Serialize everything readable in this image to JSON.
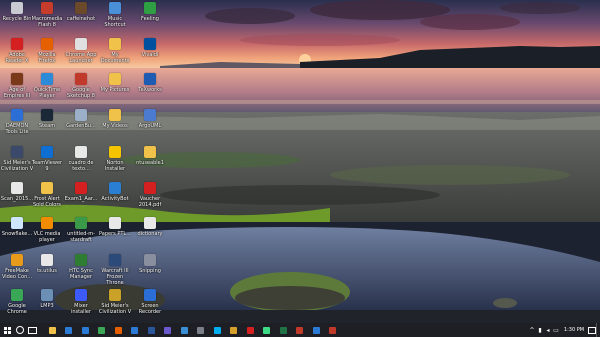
{
  "desktop": {
    "icons": [
      {
        "label": "Recycle Bin",
        "icon": "recycle-bin-icon",
        "color": "#c8ccd2"
      },
      {
        "label": "Adobe Reader X",
        "icon": "adobe-reader-icon",
        "color": "#d42020"
      },
      {
        "label": "Age of Empires III",
        "icon": "age-of-empires-icon",
        "color": "#7a3a1a"
      },
      {
        "label": "DAEMON Tools Lite",
        "icon": "daemon-tools-icon",
        "color": "#2b6fd6"
      },
      {
        "label": "Sid Meier's Civilization V",
        "icon": "civilization-icon",
        "color": "#3b4a6b"
      },
      {
        "label": "Scan_2015...",
        "icon": "document-icon",
        "color": "#e8e8e8"
      },
      {
        "label": "Snowflake...",
        "icon": "snowflake-icon",
        "color": "#cfe6ff"
      },
      {
        "label": "FreeMake Video Con...",
        "icon": "freemake-icon",
        "color": "#e89a1a"
      },
      {
        "label": "Google Chrome",
        "icon": "chrome-icon",
        "color": "#3aa757"
      },
      {
        "label": "Macromedia Flash 8",
        "icon": "flash-icon",
        "color": "#c63c2a"
      },
      {
        "label": "Mozilla Firefox",
        "icon": "firefox-icon",
        "color": "#e66000"
      },
      {
        "label": "QuickTime Player",
        "icon": "quicktime-icon",
        "color": "#2c8bd8"
      },
      {
        "label": "Steam",
        "icon": "steam-icon",
        "color": "#1b2838"
      },
      {
        "label": "TeamViewer 9",
        "icon": "teamviewer-icon",
        "color": "#0e6ed2"
      },
      {
        "label": "Frost Alert Sold Colors",
        "icon": "folder-icon",
        "color": "#f0c24a"
      },
      {
        "label": "VLC media player",
        "icon": "vlc-icon",
        "color": "#f08c00"
      },
      {
        "label": "ts.utilus",
        "icon": "document-icon",
        "color": "#e8e8e8"
      },
      {
        "label": "LMP3",
        "icon": "audio-icon",
        "color": "#6b8fb5"
      },
      {
        "label": "caffeinehot",
        "icon": "caffeine-icon",
        "color": "#6b4a2b"
      },
      {
        "label": "Chrome App Launcher",
        "icon": "app-launcher-icon",
        "color": "#e0e0e0"
      },
      {
        "label": "Google Sketchup 8",
        "icon": "sketchup-icon",
        "color": "#c0392b"
      },
      {
        "label": "GardenBu...",
        "icon": "document-icon",
        "color": "#9bb0c8"
      },
      {
        "label": "cuadro de texto...",
        "icon": "pdf-icon",
        "color": "#e8e8e8"
      },
      {
        "label": "Exam1_Aar...",
        "icon": "pdf-icon",
        "color": "#d42020"
      },
      {
        "label": "untitled-m-stardraft",
        "icon": "document-icon",
        "color": "#3a9a4a"
      },
      {
        "label": "HTC Sync Manager",
        "icon": "htc-sync-icon",
        "color": "#2e7d32"
      },
      {
        "label": "Mixer installer",
        "icon": "installer-icon",
        "color": "#3d5afe"
      },
      {
        "label": "Music Shortcut",
        "icon": "music-icon",
        "color": "#4a90d9"
      },
      {
        "label": "My Documents",
        "icon": "documents-icon",
        "color": "#f0c24a"
      },
      {
        "label": "My Pictures",
        "icon": "pictures-icon",
        "color": "#f0c24a"
      },
      {
        "label": "My Videos",
        "icon": "videos-icon",
        "color": "#f0c24a"
      },
      {
        "label": "Norton Installer",
        "icon": "norton-icon",
        "color": "#f5c400"
      },
      {
        "label": "ActivityBot",
        "icon": "activitybot-icon",
        "color": "#2a7fd4"
      },
      {
        "label": "Papers PTL...",
        "icon": "document-icon",
        "color": "#e8e8e8"
      },
      {
        "label": "Warcraft III Frozen Throne",
        "icon": "warcraft-icon",
        "color": "#2b4a7a"
      },
      {
        "label": "Sid Meier's Civilization V",
        "icon": "civilization-icon",
        "color": "#c9a227"
      },
      {
        "label": "Feeling",
        "icon": "feeling-icon",
        "color": "#2ea043"
      },
      {
        "label": "Vivaldi",
        "icon": "vivaldi-icon",
        "color": "#0050a0"
      },
      {
        "label": "TeXworks",
        "icon": "texworks-icon",
        "color": "#1e5cb3"
      },
      {
        "label": "ArgoUML",
        "icon": "argouml-icon",
        "color": "#4a7bd0"
      },
      {
        "label": "ntuseable1",
        "icon": "folder-icon",
        "color": "#f0c24a"
      },
      {
        "label": "Vaucher 2014.pdf",
        "icon": "pdf-icon",
        "color": "#d42020"
      },
      {
        "label": "dictionary",
        "icon": "document-icon",
        "color": "#e8e8e8"
      },
      {
        "label": "Snipping",
        "icon": "snipping-icon",
        "color": "#8a8fa0"
      },
      {
        "label": "Screen Recorder",
        "icon": "recorder-icon",
        "color": "#2b6fd6"
      }
    ]
  },
  "taskbar": {
    "pinned": [
      {
        "icon": "file-explorer-icon",
        "color": "#f0c24a"
      },
      {
        "icon": "edge-icon",
        "color": "#2b7bd6"
      },
      {
        "icon": "store-icon",
        "color": "#2b7bd6"
      },
      {
        "icon": "chrome-icon",
        "color": "#3aa757"
      },
      {
        "icon": "firefox-icon",
        "color": "#e66000"
      },
      {
        "icon": "mail-icon",
        "color": "#2b7bd6"
      },
      {
        "icon": "word-icon",
        "color": "#2b579a"
      },
      {
        "icon": "media-icon",
        "color": "#6a5acd"
      },
      {
        "icon": "photos-icon",
        "color": "#3a8fd6"
      },
      {
        "icon": "calculator-icon",
        "color": "#7a7f8a"
      },
      {
        "icon": "skype-icon",
        "color": "#00aff0"
      },
      {
        "icon": "paint-icon",
        "color": "#d6a12b"
      },
      {
        "icon": "acrobat-icon",
        "color": "#d42020"
      },
      {
        "icon": "android-studio-icon",
        "color": "#3ddc84"
      },
      {
        "icon": "excel-icon",
        "color": "#217346"
      },
      {
        "icon": "vivaldi-icon",
        "color": "#c0392b"
      },
      {
        "icon": "terminal-icon",
        "color": "#2b7bd6"
      },
      {
        "icon": "app-icon",
        "color": "#c0392b"
      }
    ],
    "clock_time": "1:30 PM",
    "clock_date": ""
  }
}
